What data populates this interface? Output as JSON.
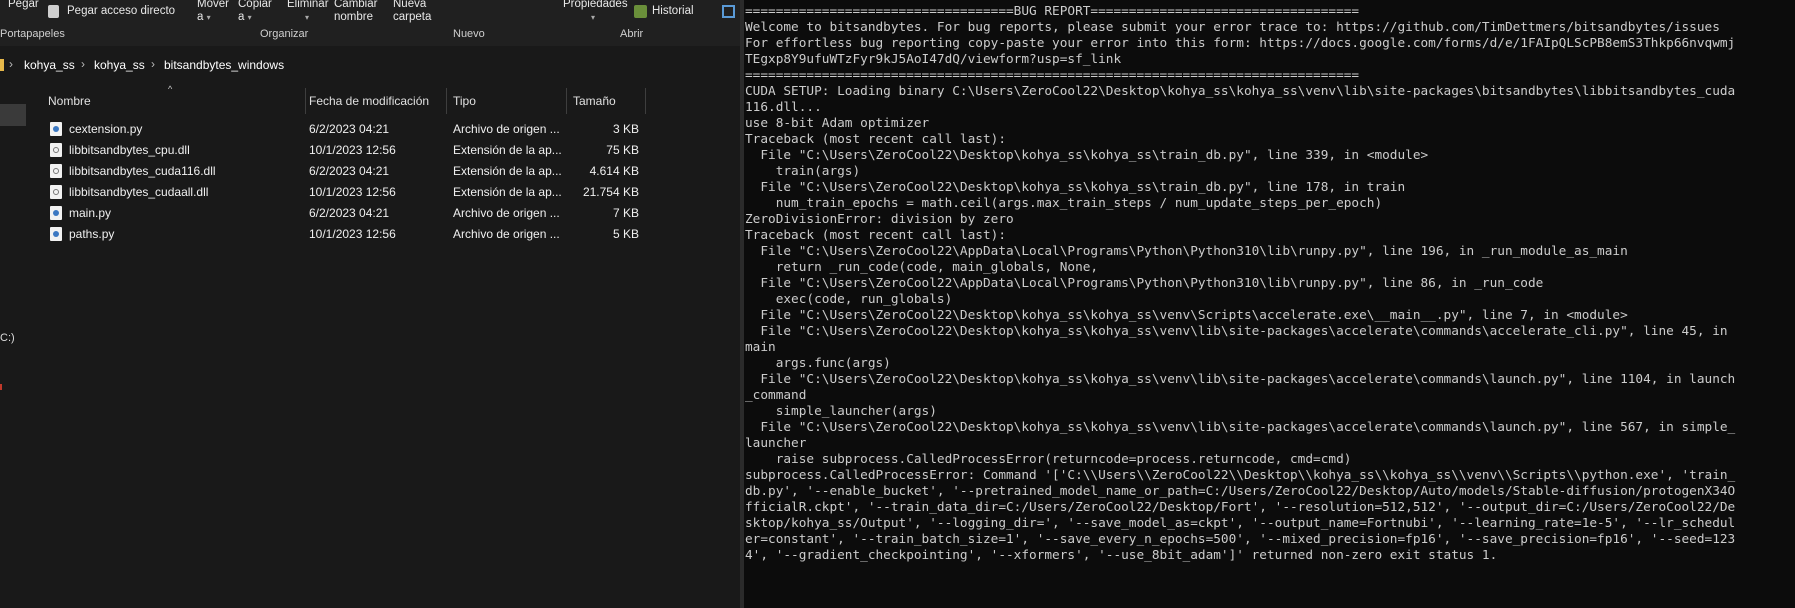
{
  "ribbon": {
    "pegar": "Pegar",
    "pegar_acceso": "Pegar acceso directo",
    "mover_a": [
      "Mover",
      "a"
    ],
    "copiar_a": [
      "Copiar",
      "a"
    ],
    "eliminar": "Eliminar",
    "cambiar_nombre": [
      "Cambiar",
      "nombre"
    ],
    "nueva_carpeta": [
      "Nueva",
      "carpeta"
    ],
    "propiedades": "Propiedades",
    "historial": "Historial",
    "groups": {
      "portapapeles": "Portapapeles",
      "organizar": "Organizar",
      "nuevo": "Nuevo",
      "abrir": "Abrir"
    }
  },
  "breadcrumb": [
    "kohya_ss",
    "kohya_ss",
    "bitsandbytes_windows"
  ],
  "left_nav": {
    "drive_label": "C:)"
  },
  "columns": {
    "nombre": "Nombre",
    "fecha": "Fecha de modificación",
    "tipo": "Tipo",
    "tamano": "Tamaño"
  },
  "files": [
    {
      "name": "cextension.py",
      "date": "6/2/2023 04:21",
      "type": "Archivo de origen ...",
      "size": "3 KB",
      "icon": "python-file-icon"
    },
    {
      "name": "libbitsandbytes_cpu.dll",
      "date": "10/1/2023 12:56",
      "type": "Extensión de la ap...",
      "size": "75 KB",
      "icon": "dll-file-icon"
    },
    {
      "name": "libbitsandbytes_cuda116.dll",
      "date": "6/2/2023 04:21",
      "type": "Extensión de la ap...",
      "size": "4.614 KB",
      "icon": "dll-file-icon"
    },
    {
      "name": "libbitsandbytes_cudaall.dll",
      "date": "10/1/2023 12:56",
      "type": "Extensión de la ap...",
      "size": "21.754 KB",
      "icon": "dll-file-icon"
    },
    {
      "name": "main.py",
      "date": "6/2/2023 04:21",
      "type": "Archivo de origen ...",
      "size": "7 KB",
      "icon": "python-file-icon"
    },
    {
      "name": "paths.py",
      "date": "10/1/2023 12:56",
      "type": "Archivo de origen ...",
      "size": "5 KB",
      "icon": "python-file-icon"
    }
  ],
  "console_lines": [
    "===================================BUG REPORT===================================",
    "Welcome to bitsandbytes. For bug reports, please submit your error trace to: https://github.com/TimDettmers/bitsandbytes/issues",
    "For effortless bug reporting copy-paste your error into this form: https://docs.google.com/forms/d/e/1FAIpQLScPB8emS3Thkp66nvqwmj",
    "TEgxp8Y9ufuWTzFyr9kJ5AoI47dQ/viewform?usp=sf_link",
    "================================================================================",
    "CUDA SETUP: Loading binary C:\\Users\\ZeroCool22\\Desktop\\kohya_ss\\kohya_ss\\venv\\lib\\site-packages\\bitsandbytes\\libbitsandbytes_cuda",
    "116.dll...",
    "use 8-bit Adam optimizer",
    "Traceback (most recent call last):",
    "  File \"C:\\Users\\ZeroCool22\\Desktop\\kohya_ss\\kohya_ss\\train_db.py\", line 339, in <module>",
    "    train(args)",
    "  File \"C:\\Users\\ZeroCool22\\Desktop\\kohya_ss\\kohya_ss\\train_db.py\", line 178, in train",
    "    num_train_epochs = math.ceil(args.max_train_steps / num_update_steps_per_epoch)",
    "ZeroDivisionError: division by zero",
    "Traceback (most recent call last):",
    "  File \"C:\\Users\\ZeroCool22\\AppData\\Local\\Programs\\Python\\Python310\\lib\\runpy.py\", line 196, in _run_module_as_main",
    "    return _run_code(code, main_globals, None,",
    "  File \"C:\\Users\\ZeroCool22\\AppData\\Local\\Programs\\Python\\Python310\\lib\\runpy.py\", line 86, in _run_code",
    "    exec(code, run_globals)",
    "  File \"C:\\Users\\ZeroCool22\\Desktop\\kohya_ss\\kohya_ss\\venv\\Scripts\\accelerate.exe\\__main__.py\", line 7, in <module>",
    "  File \"C:\\Users\\ZeroCool22\\Desktop\\kohya_ss\\kohya_ss\\venv\\lib\\site-packages\\accelerate\\commands\\accelerate_cli.py\", line 45, in",
    "main",
    "    args.func(args)",
    "  File \"C:\\Users\\ZeroCool22\\Desktop\\kohya_ss\\kohya_ss\\venv\\lib\\site-packages\\accelerate\\commands\\launch.py\", line 1104, in launch",
    "_command",
    "    simple_launcher(args)",
    "  File \"C:\\Users\\ZeroCool22\\Desktop\\kohya_ss\\kohya_ss\\venv\\lib\\site-packages\\accelerate\\commands\\launch.py\", line 567, in simple_",
    "launcher",
    "    raise subprocess.CalledProcessError(returncode=process.returncode, cmd=cmd)",
    "subprocess.CalledProcessError: Command '['C:\\\\Users\\\\ZeroCool22\\\\Desktop\\\\kohya_ss\\\\kohya_ss\\\\venv\\\\Scripts\\\\python.exe', 'train_",
    "db.py', '--enable_bucket', '--pretrained_model_name_or_path=C:/Users/ZeroCool22/Desktop/Auto/models/Stable-diffusion/protogenX34O",
    "fficialR.ckpt', '--train_data_dir=C:/Users/ZeroCool22/Desktop/Fort', '--resolution=512,512', '--output_dir=C:/Users/ZeroCool22/De",
    "sktop/kohya_ss/Output', '--logging_dir=', '--save_model_as=ckpt', '--output_name=Fortnubi', '--learning_rate=1e-5', '--lr_schedul",
    "er=constant', '--train_batch_size=1', '--save_every_n_epochs=500', '--mixed_precision=fp16', '--save_precision=fp16', '--seed=123",
    "4', '--gradient_checkpointing', '--xformers', '--use_8bit_adam']' returned non-zero exit status 1."
  ]
}
